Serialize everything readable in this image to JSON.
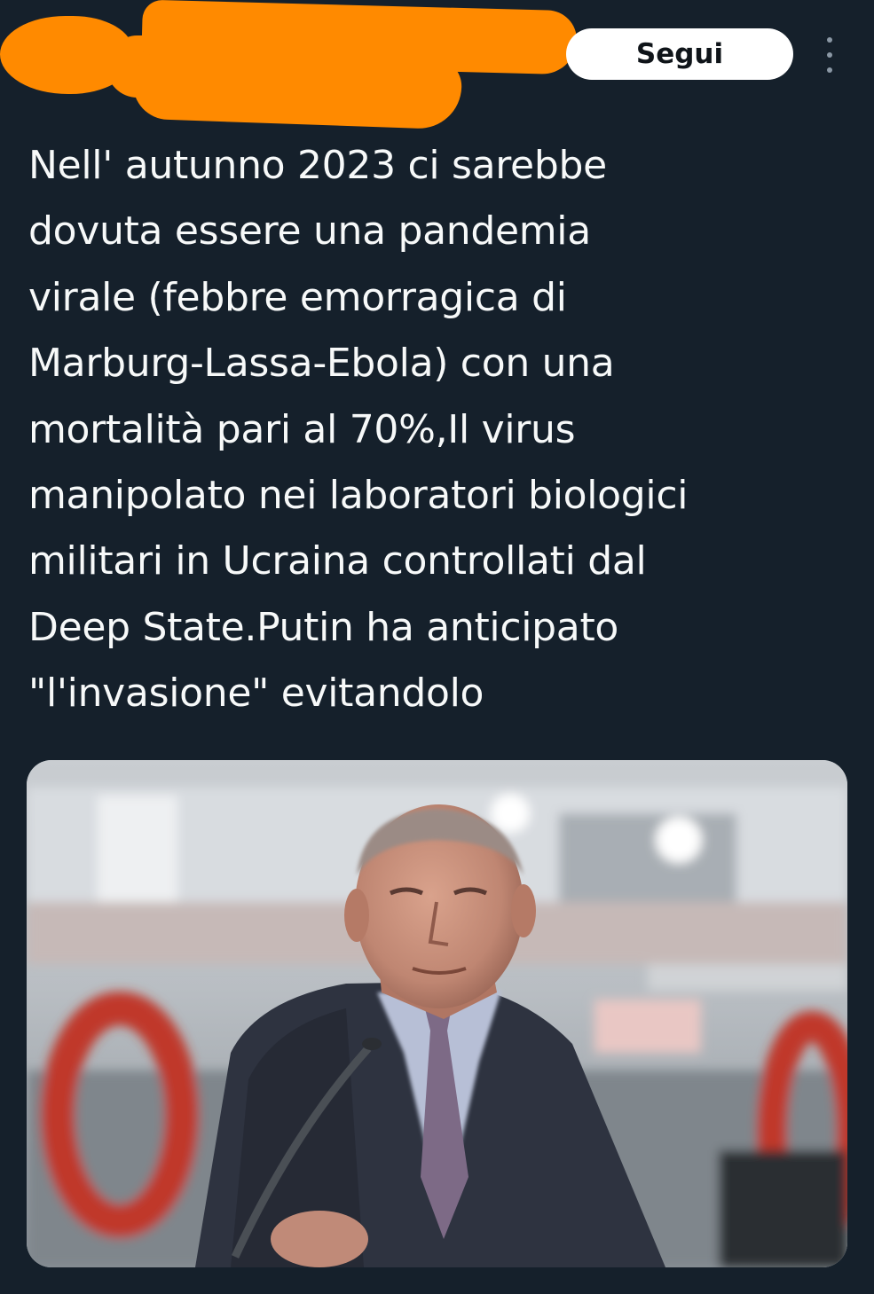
{
  "header": {
    "follow_label": "Segui",
    "more_icon": "more-vertical-icon"
  },
  "tweet": {
    "text": "Nell' autunno 2023 ci sarebbe\ndovuta essere una pandemia\nvirale (febbre emorragica di\nMarburg-Lassa-Ebola) con una\nmortalità pari al 70%,Il virus\nmanipolato nei laboratori biologici\nmilitari in Ucraina controllati dal\nDeep State.Putin ha anticipato\n\"l'invasione\" evitandolo"
  },
  "colors": {
    "background": "#15202b",
    "text": "#f7f9f9",
    "follow_button_bg": "#ffffff",
    "follow_button_text": "#0f1419",
    "redaction": "#ff8a00"
  }
}
